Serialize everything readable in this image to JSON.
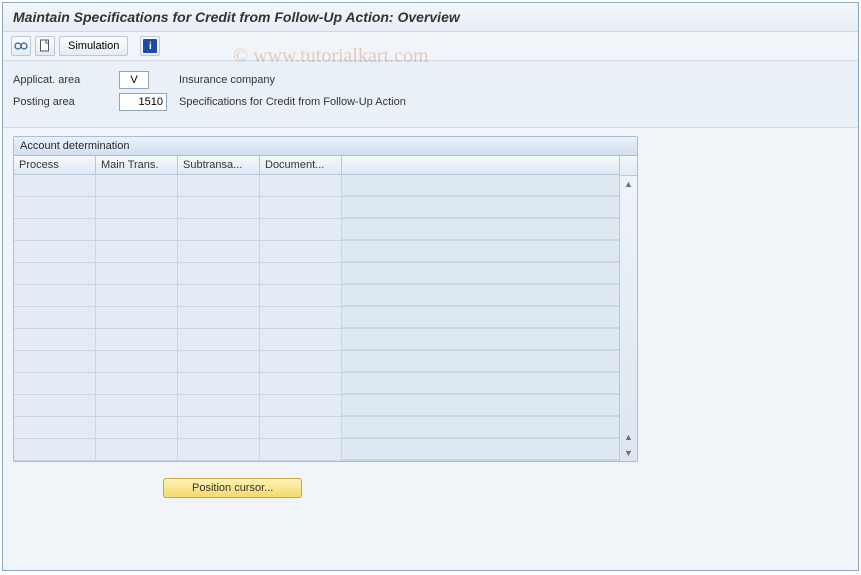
{
  "title": "Maintain Specifications for Credit from Follow-Up Action: Overview",
  "toolbar": {
    "simulation_label": "Simulation"
  },
  "form": {
    "applicat_area_label": "Applicat. area",
    "applicat_area_value": "V",
    "applicat_area_desc": "Insurance company",
    "posting_area_label": "Posting area",
    "posting_area_value": "1510",
    "posting_area_desc": "Specifications for Credit from Follow-Up Action"
  },
  "panel": {
    "header": "Account determination",
    "columns": [
      "Process",
      "Main Trans.",
      "Subtransa...",
      "Document..."
    ],
    "rows": [
      [
        "",
        "",
        "",
        ""
      ],
      [
        "",
        "",
        "",
        ""
      ],
      [
        "",
        "",
        "",
        ""
      ],
      [
        "",
        "",
        "",
        ""
      ],
      [
        "",
        "",
        "",
        ""
      ],
      [
        "",
        "",
        "",
        ""
      ],
      [
        "",
        "",
        "",
        ""
      ],
      [
        "",
        "",
        "",
        ""
      ],
      [
        "",
        "",
        "",
        ""
      ],
      [
        "",
        "",
        "",
        ""
      ],
      [
        "",
        "",
        "",
        ""
      ],
      [
        "",
        "",
        "",
        ""
      ],
      [
        "",
        "",
        "",
        ""
      ]
    ]
  },
  "buttons": {
    "position_cursor": "Position cursor..."
  },
  "watermark": "© www.tutorialkart.com"
}
